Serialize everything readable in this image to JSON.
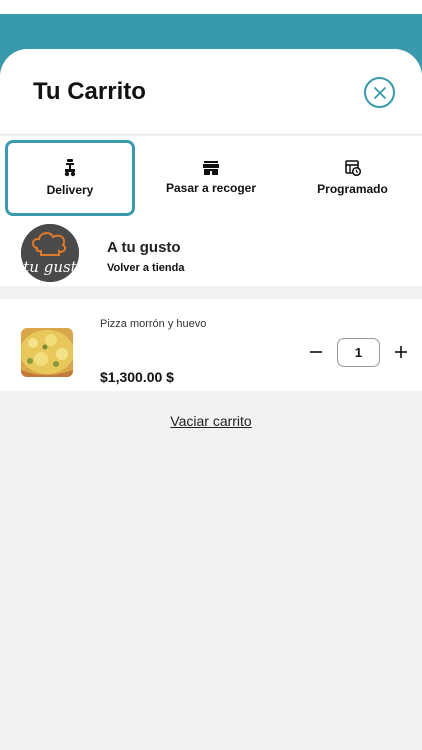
{
  "colors": {
    "accent": "#3a9aad"
  },
  "header": {
    "title": "Tu Carrito",
    "close_icon": "close-circle-icon"
  },
  "tabs": [
    {
      "label": "Delivery",
      "icon": "scooter-icon",
      "active": true
    },
    {
      "label": "Pasar a recoger",
      "icon": "store-icon",
      "active": false
    },
    {
      "label": "Programado",
      "icon": "calendar-clock-icon",
      "active": false
    }
  ],
  "store": {
    "name": "A tu gusto",
    "link": "Volver a tienda",
    "logo_text": "tu gust"
  },
  "cart": {
    "items": [
      {
        "name": "Pizza morrón y huevo",
        "price": "$1,300.00 $",
        "quantity": "1"
      }
    ],
    "empty_label": "Vaciar carrito"
  }
}
